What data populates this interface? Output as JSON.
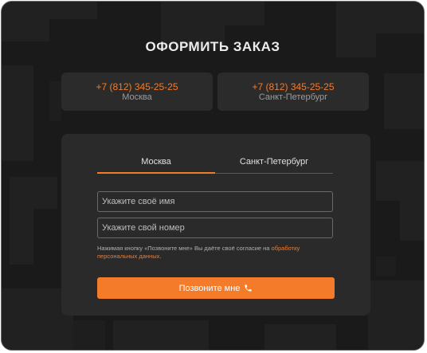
{
  "modal": {
    "title": "ОФОРМИТЬ ЗАКАЗ"
  },
  "contacts": [
    {
      "phone": "+7 (812) 345-25-25",
      "city": "Москва"
    },
    {
      "phone": "+7 (812) 345-25-25",
      "city": "Санкт-Петербург"
    }
  ],
  "form": {
    "tabs": [
      {
        "label": "Москва",
        "active": true
      },
      {
        "label": "Санкт-Петербург",
        "active": false
      }
    ],
    "name_placeholder": "Укажите своё имя",
    "phone_placeholder": "Укажите свой номер",
    "consent_text": "Нажимая кнопку «Позвоните мне» Вы даёте своё согласие на ",
    "consent_link": "обработку персональных данных",
    "consent_end": ".",
    "submit_label": "Позвоните мне",
    "submit_icon": "phone-icon"
  },
  "colors": {
    "accent": "#f47b2a",
    "background": "#1a1a1a",
    "card": "#2b2b2b"
  }
}
